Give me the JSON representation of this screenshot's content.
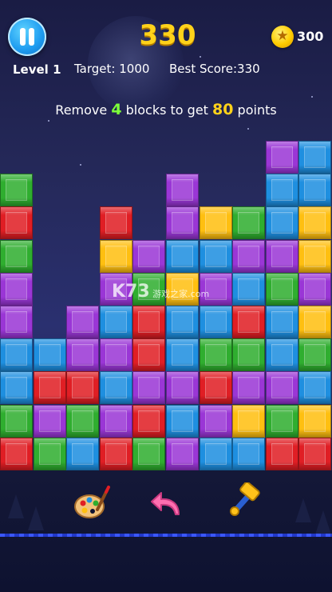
{
  "hud": {
    "score": "330",
    "level_label": "Level",
    "level_value": "1",
    "target_text": "Target: 1000",
    "best_text": "Best Score:330",
    "coins": "300"
  },
  "hint": {
    "prefix": "Remove ",
    "blocks_count": "4",
    "middle": " blocks to get ",
    "points": "80",
    "suffix": " points"
  },
  "watermark": {
    "brand": "K73",
    "site_cn": "游戏之家",
    "domain": ".com"
  },
  "colors": {
    "G": "#2fae2f",
    "R": "#e01e24",
    "P": "#9a36d6",
    "B": "#1e8fe0",
    "Y": "#ffbf10"
  },
  "board": {
    "columns": 10,
    "rows": 10,
    "grid": [
      "..........",
      "........PB",
      "G....P..BB",
      "R..R.PYGBY",
      "G..YPBBPPY",
      "P..PGYPBGP",
      "P.PBRBBRBY",
      "BBPPRBGGBG",
      "BRRBPPRPPB",
      "GPGPRBPYGY",
      "RGBRGPBBRR"
    ]
  },
  "tools": {
    "palette": "palette-icon",
    "undo": "undo-arrow-icon",
    "hammer": "hammer-icon"
  }
}
